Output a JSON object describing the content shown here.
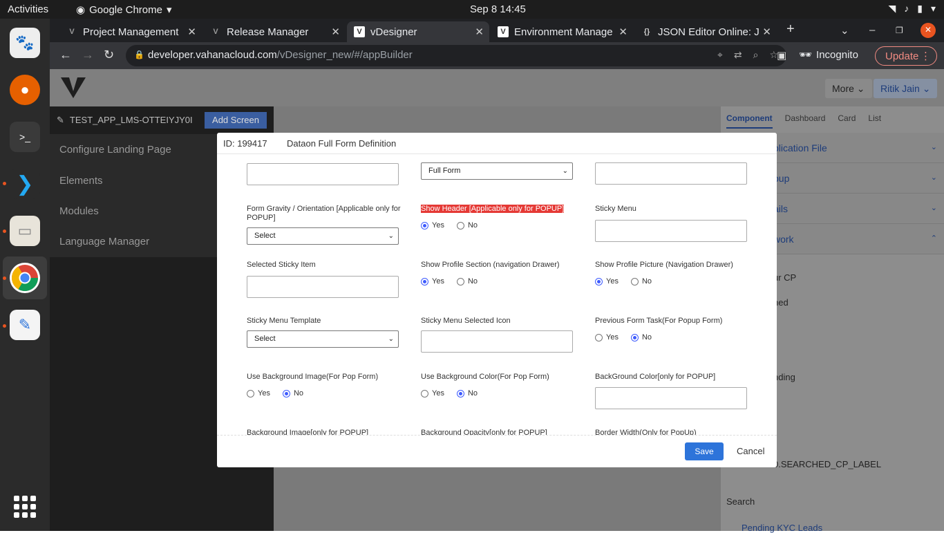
{
  "topbar": {
    "activities": "Activities",
    "app_name": "Google Chrome",
    "clock": "Sep 8  14:45"
  },
  "dock": {
    "icons": [
      "gimp-icon",
      "firefox-icon",
      "terminal-icon",
      "vscode-icon",
      "files-icon",
      "chrome-icon",
      "text-editor-icon",
      "apps-grid-icon"
    ]
  },
  "browser": {
    "tabs": [
      {
        "title": "Project Management",
        "active": false
      },
      {
        "title": "Release Manager",
        "active": false
      },
      {
        "title": "vDesigner",
        "active": true
      },
      {
        "title": "Environment Manage",
        "active": false
      },
      {
        "title": "JSON Editor Online: J",
        "active": false
      }
    ],
    "url_host": "developer.vahanacloud.com",
    "url_path": "/vDesigner_new/#/appBuilder",
    "incognito_label": "Incognito",
    "update_label": "Update"
  },
  "app": {
    "more_label": "More",
    "user_name": "Ritik Jain",
    "app_name": "TEST_APP_LMS-OTTEIYJY0I",
    "add_screen_label": "Add Screen",
    "menu": [
      "Configure Landing Page",
      "Elements",
      "Modules",
      "Language Manager"
    ],
    "right_tabs": [
      "Component",
      "Dashboard",
      "Card",
      "List"
    ],
    "right_accordions": [
      "plication File",
      "pup",
      "ails",
      "work"
    ],
    "right_texts": [
      "ur CP",
      "hed",
      "nding",
      "0.SEARCHED_CP_LABEL",
      "Search",
      "Pending KYC Leads"
    ]
  },
  "modal": {
    "id_label": "ID: 199417",
    "name": "Dataon Full Form Definition",
    "top_select_value": "Full Form",
    "fields": {
      "form_gravity": {
        "label": "Form Gravity / Orientation [Applicable only for POPUP]",
        "value": "Select"
      },
      "show_header": {
        "label": "Show Header [Applicable only for POPUP]",
        "selected": "Yes"
      },
      "sticky_menu": {
        "label": "Sticky Menu"
      },
      "selected_sticky_item": {
        "label": "Selected Sticky Item"
      },
      "show_profile_section": {
        "label": "Show Profile Section (navigation Drawer)",
        "selected": "Yes"
      },
      "show_profile_picture": {
        "label": "Show Profile Picture (Navigation Drawer)",
        "selected": "Yes"
      },
      "sticky_menu_template": {
        "label": "Sticky Menu Template",
        "value": "Select"
      },
      "sticky_menu_selected_icon": {
        "label": "Sticky Menu Selected Icon"
      },
      "previous_form_task": {
        "label": "Previous Form Task(For Popup Form)",
        "selected": "No"
      },
      "use_bg_image": {
        "label": "Use Background Image(For Pop Form)",
        "selected": "No"
      },
      "use_bg_color": {
        "label": "Use Background Color(For Pop Form)",
        "selected": "No"
      },
      "bg_color": {
        "label": "BackGround Color[only for POPUP]"
      },
      "bg_image": {
        "label": "Background Image[only for POPUP]"
      },
      "bg_opacity": {
        "label": "Background Opacity[only for POPUP]"
      },
      "border_width": {
        "label": "Border Width(Only for PopUp)"
      }
    },
    "yes_label": "Yes",
    "no_label": "No",
    "save_label": "Save",
    "cancel_label": "Cancel"
  },
  "colors": {
    "accent": "#2d74da",
    "highlight": "#e53935",
    "brand_dark": "#1d3c7a"
  }
}
